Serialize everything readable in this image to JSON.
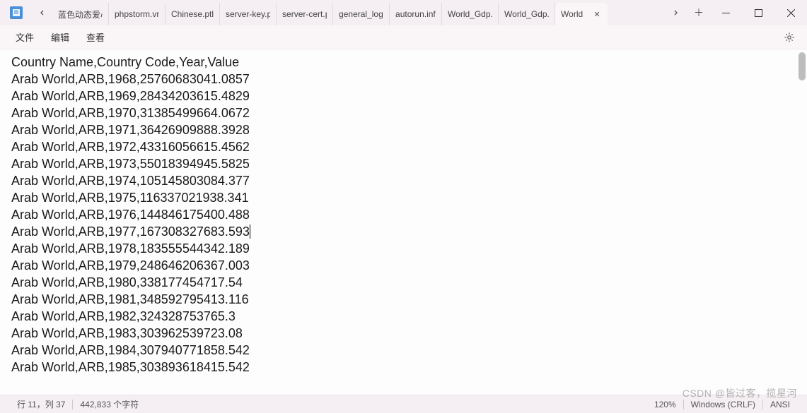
{
  "tabs": {
    "items": [
      {
        "label": "蓝色动态爱心"
      },
      {
        "label": "phpstorm.vn"
      },
      {
        "label": "Chinese.ptl"
      },
      {
        "label": "server-key.p"
      },
      {
        "label": "server-cert.p"
      },
      {
        "label": "general_log."
      },
      {
        "label": "autorun.inf"
      },
      {
        "label": "World_Gdp.c"
      },
      {
        "label": "World_Gdp.c"
      }
    ],
    "active": {
      "label": "World"
    }
  },
  "menu": {
    "file": "文件",
    "edit": "编辑",
    "view": "查看"
  },
  "content_lines": [
    "Country Name,Country Code,Year,Value",
    "Arab World,ARB,1968,25760683041.0857",
    "Arab World,ARB,1969,28434203615.4829",
    "Arab World,ARB,1970,31385499664.0672",
    "Arab World,ARB,1971,36426909888.3928",
    "Arab World,ARB,1972,43316056615.4562",
    "Arab World,ARB,1973,55018394945.5825",
    "Arab World,ARB,1974,105145803084.377",
    "Arab World,ARB,1975,116337021938.341",
    "Arab World,ARB,1976,144846175400.488",
    "Arab World,ARB,1977,167308327683.593",
    "Arab World,ARB,1978,183555544342.189",
    "Arab World,ARB,1979,248646206367.003",
    "Arab World,ARB,1980,338177454717.54",
    "Arab World,ARB,1981,348592795413.116",
    "Arab World,ARB,1982,324328753765.3",
    "Arab World,ARB,1983,303962539723.08",
    "Arab World,ARB,1984,307940771858.542",
    "Arab World,ARB,1985,303893618415.542"
  ],
  "caret_line_index": 10,
  "status": {
    "position": "行 11，列 37",
    "char_count": "442,833 个字符",
    "zoom": "120%",
    "line_ending": "Windows (CRLF)",
    "encoding": "ANSI"
  },
  "watermark": "CSDN @皆过客，揽星河"
}
